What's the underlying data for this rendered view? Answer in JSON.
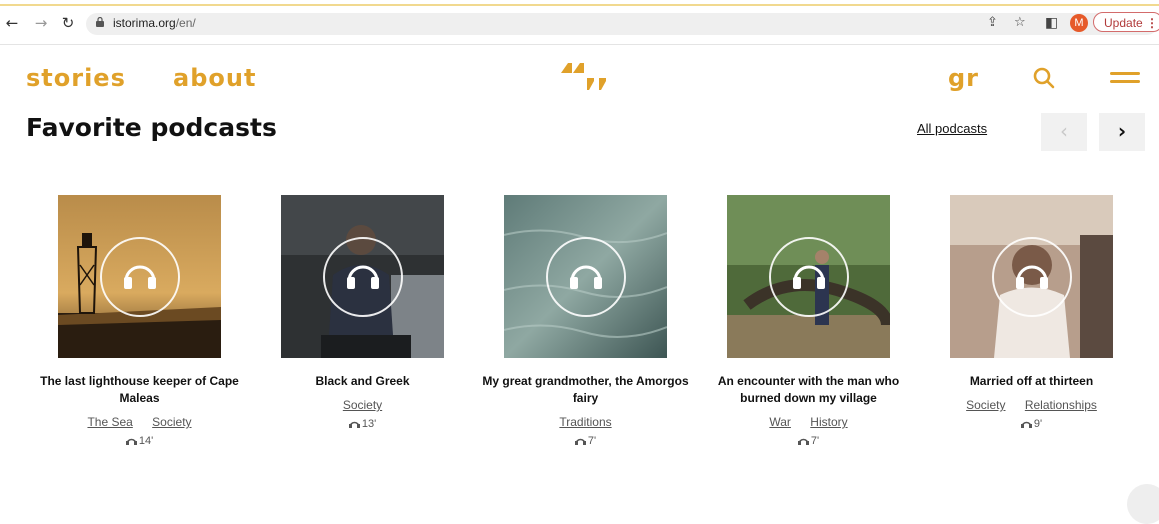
{
  "browser": {
    "url_host": "istorima.org",
    "url_path": "/en/",
    "avatar_letter": "M",
    "update_label": "Update"
  },
  "site_nav": {
    "stories": "stories",
    "about": "about",
    "language": "gr",
    "accent_color": "#e0a12a"
  },
  "section": {
    "title": "Favorite podcasts",
    "all_link": "All podcasts",
    "prev_label": "‹",
    "next_label": "›"
  },
  "podcasts": [
    {
      "title": "The last lighthouse keeper of Cape Maleas",
      "tags": [
        "The Sea",
        "Society"
      ],
      "duration": "14'"
    },
    {
      "title": "Black and Greek",
      "tags": [
        "Society"
      ],
      "duration": "13'"
    },
    {
      "title": "My great grandmother, the Amorgos fairy",
      "tags": [
        "Traditions"
      ],
      "duration": "7'"
    },
    {
      "title": "An encounter with the man who burned down my village",
      "tags": [
        "War",
        "History"
      ],
      "duration": "7'"
    },
    {
      "title": "Married off at thirteen",
      "tags": [
        "Society",
        "Relationships"
      ],
      "duration": "9'"
    }
  ]
}
